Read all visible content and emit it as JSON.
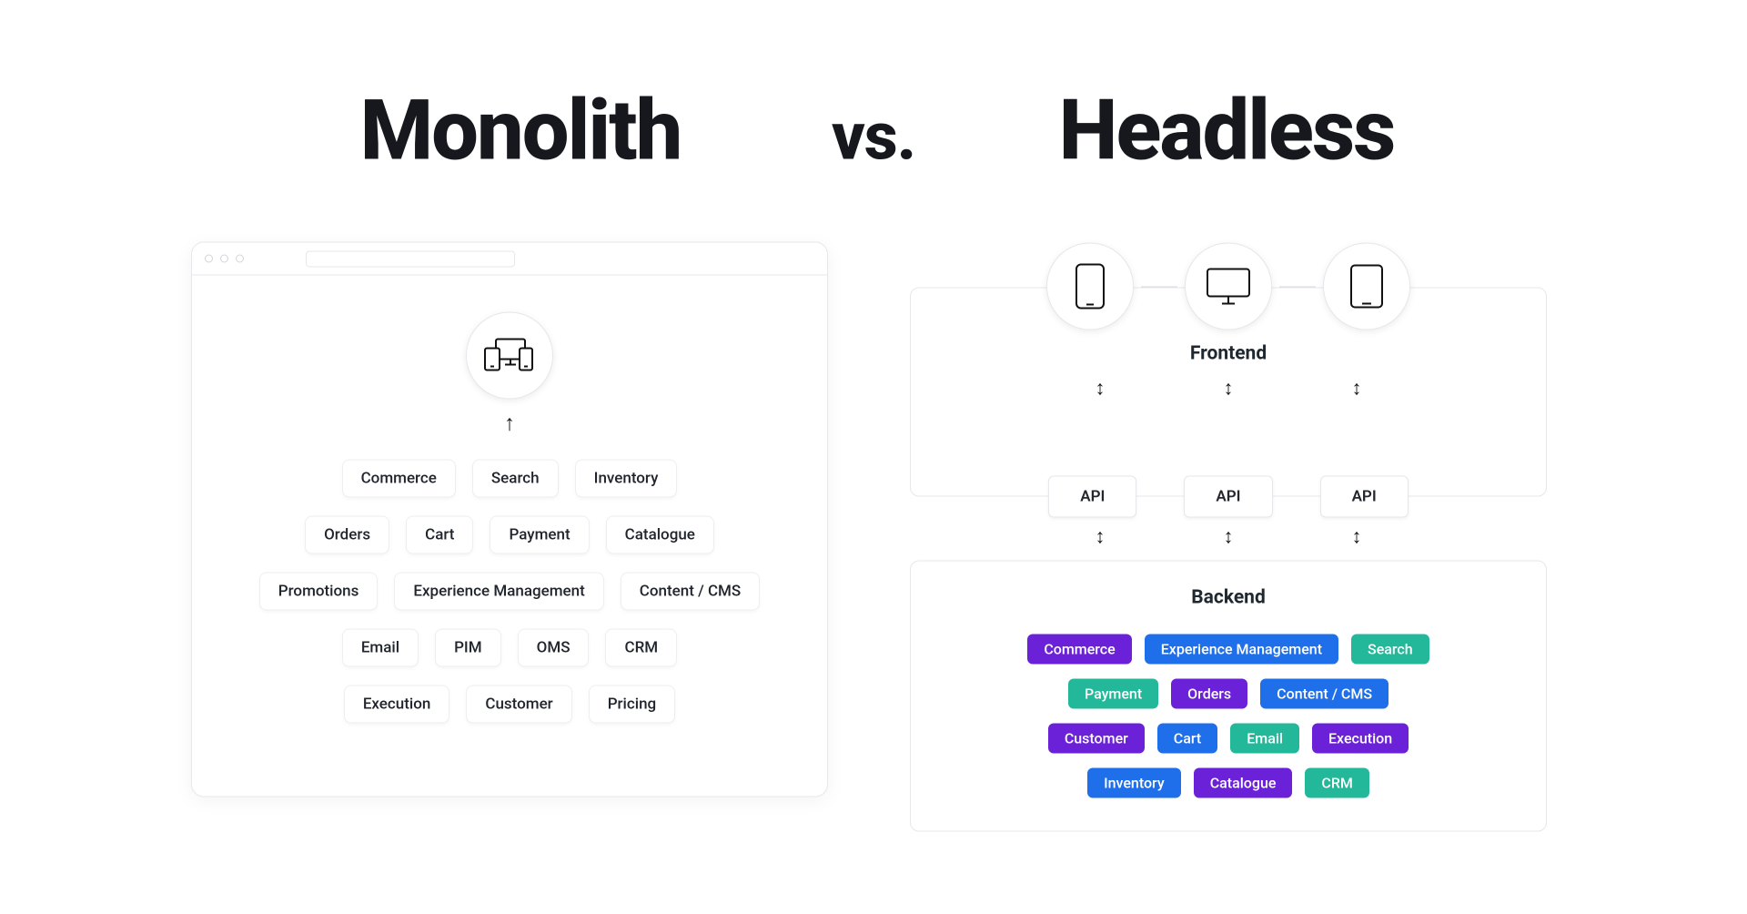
{
  "heading": {
    "left": "Monolith",
    "vs": "vs.",
    "right": "Headless"
  },
  "monolith": {
    "rows": [
      [
        "Commerce",
        "Search",
        "Inventory"
      ],
      [
        "Orders",
        "Cart",
        "Payment",
        "Catalogue"
      ],
      [
        "Promotions",
        "Experience Management",
        "Content / CMS"
      ],
      [
        "Email",
        "PIM",
        "OMS",
        "CRM"
      ],
      [
        "Execution",
        "Customer",
        "Pricing"
      ]
    ]
  },
  "headless": {
    "frontend_label": "Frontend",
    "backend_label": "Backend",
    "api_label": "API",
    "api_count": 3,
    "backend_rows": [
      [
        {
          "label": "Commerce",
          "color": "purple"
        },
        {
          "label": "Experience Management",
          "color": "blue"
        },
        {
          "label": "Search",
          "color": "teal"
        }
      ],
      [
        {
          "label": "Payment",
          "color": "teal"
        },
        {
          "label": "Orders",
          "color": "purple"
        },
        {
          "label": "Content / CMS",
          "color": "blue"
        }
      ],
      [
        {
          "label": "Customer",
          "color": "purple"
        },
        {
          "label": "Cart",
          "color": "blue"
        },
        {
          "label": "Email",
          "color": "teal"
        },
        {
          "label": "Execution",
          "color": "purple"
        }
      ],
      [
        {
          "label": "Inventory",
          "color": "blue"
        },
        {
          "label": "Catalogue",
          "color": "purple"
        },
        {
          "label": "CRM",
          "color": "teal"
        }
      ]
    ]
  }
}
